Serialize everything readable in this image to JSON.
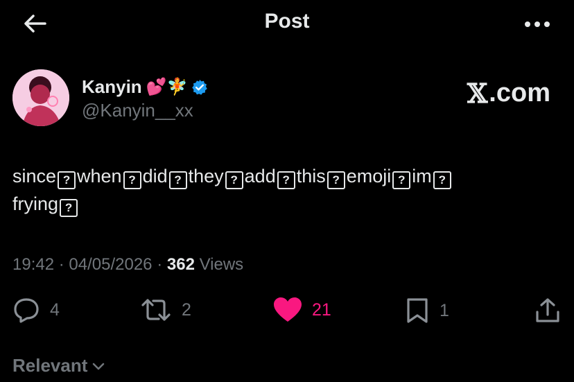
{
  "header": {
    "title": "Post",
    "back_icon": "back-arrow-icon",
    "more_icon": "more-options-icon"
  },
  "author": {
    "name": "Kanyin",
    "name_emojis": "💕🧚",
    "handle": "@Kanyin__xx",
    "verified": true,
    "verified_color": "#1d9bf0"
  },
  "watermark": {
    "logo": "𝕏",
    "text": ".com"
  },
  "tweet": {
    "words": [
      "since",
      "when",
      "did",
      "they",
      "add",
      "this",
      "emoji",
      "im"
    ],
    "line2_word": "frying",
    "missing_glyph": "?"
  },
  "meta": {
    "time": "19:42",
    "separator": "·",
    "date": "04/05/2026",
    "views_count": "362",
    "views_label": "Views"
  },
  "actions": {
    "replies": "4",
    "reposts": "2",
    "likes": "21",
    "bookmarks": "1",
    "like_color": "#f91880"
  },
  "sort": {
    "label": "Relevant"
  }
}
